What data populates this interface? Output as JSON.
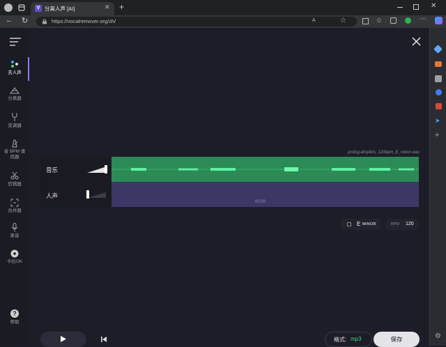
{
  "browser": {
    "tab_title": "分离人声 [AI]",
    "tab_icon_letter": "V",
    "url": "https://vocalremover.org/zh/"
  },
  "sidebar": {
    "items": [
      {
        "label": "去人声",
        "icon": "dots-icon"
      },
      {
        "label": "分离器",
        "icon": "pyramid-icon"
      },
      {
        "label": "变调器",
        "icon": "tuning-fork-icon"
      },
      {
        "label": "音 BPM 查找器",
        "icon": "metronome-icon"
      },
      {
        "label": "剪辑器",
        "icon": "scissors-icon"
      },
      {
        "label": "合并器",
        "icon": "merge-icon"
      },
      {
        "label": "录音",
        "icon": "mic-icon"
      },
      {
        "label": "卡拉OK",
        "icon": "disc-icon"
      }
    ],
    "help_label": "帮助"
  },
  "tracks": {
    "filename": "prolog-droplets_120bpm_E_minor.wav",
    "music_label": "音乐",
    "vocal_label": "人声",
    "time": "00:00",
    "music_color": "#2b8a55",
    "vocal_color": "#3d3766"
  },
  "info": {
    "key_value": "E",
    "key_mode": "MINOR",
    "bpm_label": "BPM",
    "bpm_value": "120"
  },
  "footer": {
    "format_label": "格式:",
    "format_value": "mp3",
    "save_label": "保存"
  }
}
